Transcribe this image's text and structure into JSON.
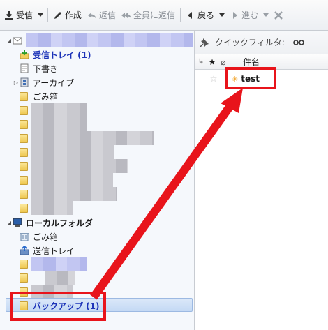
{
  "toolbar": {
    "receive": "受信",
    "compose": "作成",
    "reply": "返信",
    "reply_all": "全員に返信",
    "back": "戻る",
    "forward": "進む"
  },
  "folders": {
    "inbox": "受信トレイ (1)",
    "drafts": "下書き",
    "archive": "アーカイブ",
    "trash": "ごみ箱",
    "local_folders": "ローカルフォルダ",
    "local_trash": "ごみ箱",
    "outbox": "送信トレイ",
    "backup": "バックアップ (1)"
  },
  "messages": {
    "quick_filter": "クイックフィルタ:",
    "col_subject": "件名",
    "rows": [
      {
        "subject": "test"
      }
    ]
  },
  "colors": {
    "annotation": "#e8141b",
    "unread": "#1c33b8",
    "selection": "#c4d9f4"
  }
}
